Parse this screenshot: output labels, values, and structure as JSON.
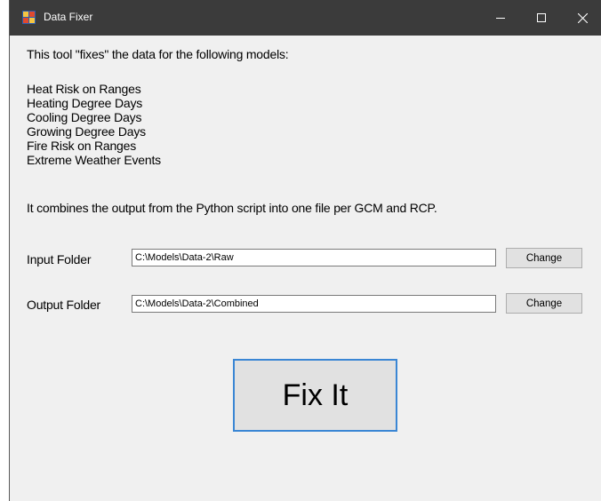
{
  "window": {
    "title": "Data Fixer"
  },
  "intro": "This tool \"fixes\" the data for the following models:",
  "models": [
    "Heat Risk on Ranges",
    "Heating Degree Days",
    "Cooling Degree Days",
    "Growing Degree Days",
    "Fire Risk on Ranges",
    "Extreme Weather Events"
  ],
  "description": "It combines the output from the Python script into one file per GCM and RCP.",
  "input": {
    "label": "Input Folder",
    "value": "C:\\Models\\Data-2\\Raw",
    "button": "Change"
  },
  "output": {
    "label": "Output Folder",
    "value": "C:\\Models\\Data-2\\Combined",
    "button": "Change"
  },
  "fix_button": "Fix It",
  "colors": {
    "titlebar": "#3b3b3b",
    "window_bg": "#f0f0f0",
    "focus_border": "#3a86d4",
    "button_bg": "#e1e1e1"
  },
  "icons": {
    "app": "app-icon",
    "minimize": "minimize-icon",
    "maximize": "maximize-icon",
    "close": "close-icon"
  }
}
